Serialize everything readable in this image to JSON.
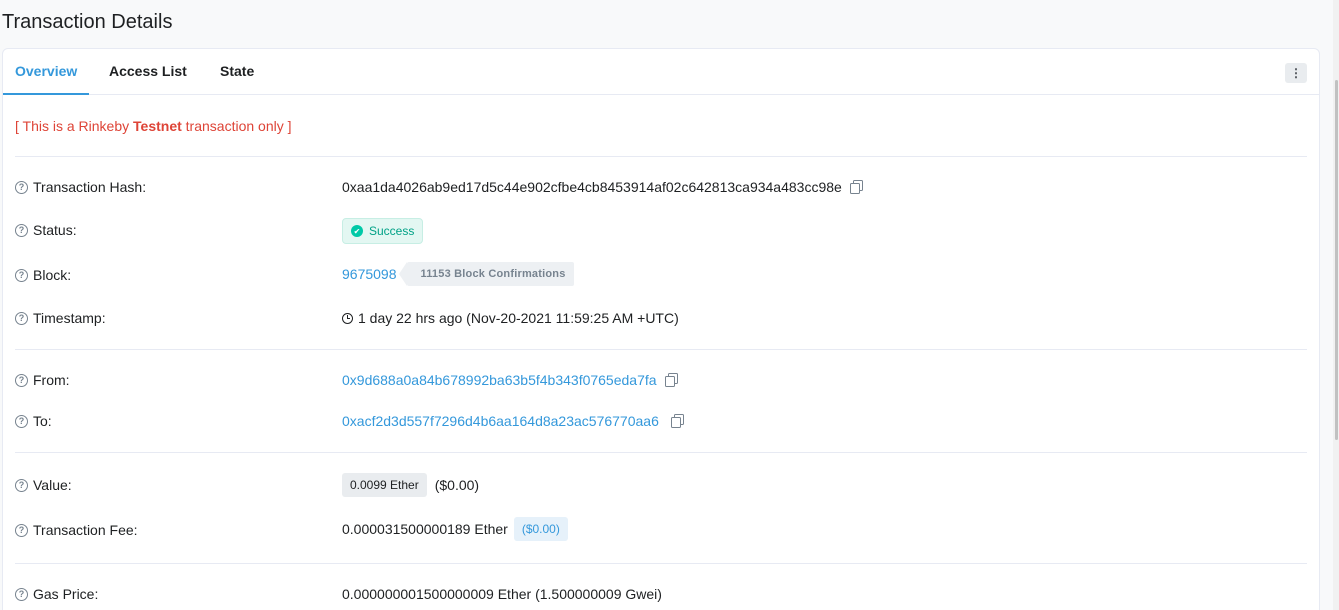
{
  "page": {
    "title": "Transaction Details"
  },
  "tabs": [
    {
      "label": "Overview",
      "active": true
    },
    {
      "label": "Access List",
      "active": false
    },
    {
      "label": "State",
      "active": false
    }
  ],
  "menu_icon": "more-vertical-icon",
  "testnet_notice": {
    "prefix": "[ This is a Rinkeby ",
    "bold": "Testnet",
    "suffix": " transaction only ]"
  },
  "rows": {
    "hash": {
      "label": "Transaction Hash:",
      "value": "0xaa1da4026ab9ed17d5c44e902cfbe4cb8453914af02c642813ca934a483cc98e"
    },
    "status": {
      "label": "Status:",
      "value": "Success"
    },
    "block": {
      "label": "Block:",
      "value": "9675098",
      "confirmations": "11153 Block Confirmations"
    },
    "timestamp": {
      "label": "Timestamp:",
      "value": "1 day 22 hrs ago (Nov-20-2021 11:59:25 AM +UTC)"
    },
    "from": {
      "label": "From:",
      "value": "0x9d688a0a84b678992ba63b5f4b343f0765eda7fa"
    },
    "to": {
      "label": "To:",
      "value": "0xacf2d3d557f7296d4b6aa164d8a23ac576770aa6"
    },
    "value": {
      "label": "Value:",
      "amount": "0.0099 Ether",
      "usd": "($0.00)"
    },
    "fee": {
      "label": "Transaction Fee:",
      "amount": "0.000031500000189 Ether",
      "usd": "($0.00)"
    },
    "gas_price": {
      "label": "Gas Price:",
      "value": "0.000000001500000009 Ether (1.500000009 Gwei)"
    }
  },
  "colors": {
    "accent": "#3498db",
    "success": "#00c9a7",
    "danger": "#de4437"
  }
}
